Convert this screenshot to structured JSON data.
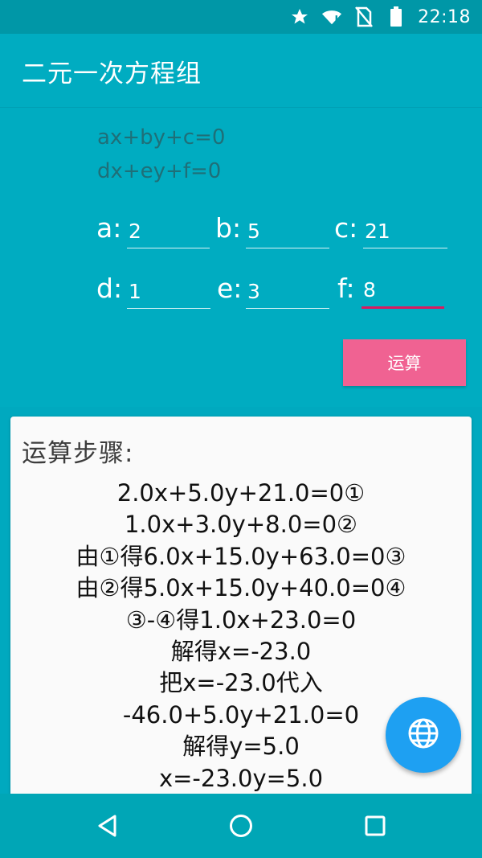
{
  "status_bar": {
    "time": "22:18"
  },
  "app_bar": {
    "title": "二元一次方程组"
  },
  "equations": [
    "ax+by+c=0",
    "dx+ey+f=0"
  ],
  "coefficients": {
    "a": {
      "label": "a:",
      "value": "2"
    },
    "b": {
      "label": "b:",
      "value": "5"
    },
    "c": {
      "label": "c:",
      "value": "21"
    },
    "d": {
      "label": "d:",
      "value": "1"
    },
    "e": {
      "label": "e:",
      "value": "3"
    },
    "f": {
      "label": "f:",
      "value": "8"
    }
  },
  "calc_button": {
    "label": "运算"
  },
  "result": {
    "title": "运算步骤:",
    "steps": [
      "2.0x+5.0y+21.0=0①",
      "1.0x+3.0y+8.0=0②",
      "由①得6.0x+15.0y+63.0=0③",
      "由②得5.0x+15.0y+40.0=0④",
      "③-④得1.0x+23.0=0",
      "解得x=-23.0",
      "把x=-23.0代入",
      "-46.0+5.0y+21.0=0",
      "解得y=5.0",
      "x=-23.0y=5.0"
    ]
  },
  "colors": {
    "primary": "#00acc1",
    "status_bar": "#0097a7",
    "accent": "#f06292",
    "fab": "#1ea0f2",
    "field_focus": "#d81b60"
  },
  "icons": {
    "status": [
      "star-icon",
      "wifi-icon",
      "no-sim-icon",
      "battery-icon"
    ],
    "fab": "globe-icon",
    "nav": [
      "back-icon",
      "home-icon",
      "recents-icon"
    ]
  }
}
